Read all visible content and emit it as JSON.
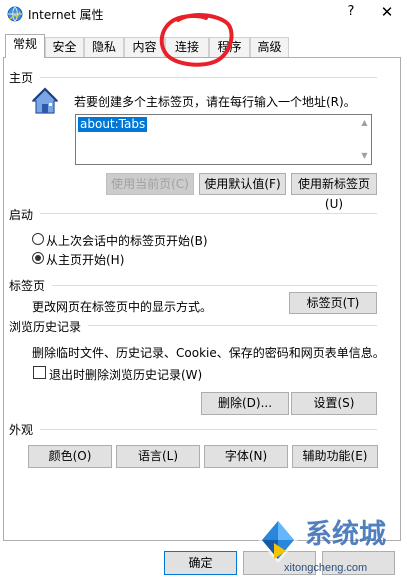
{
  "window": {
    "title": "Internet 属性",
    "help_glyph": "?",
    "close_glyph": "✕"
  },
  "tabs": [
    {
      "label": "常规",
      "active": true
    },
    {
      "label": "安全",
      "active": false
    },
    {
      "label": "隐私",
      "active": false
    },
    {
      "label": "内容",
      "active": false
    },
    {
      "label": "连接",
      "active": false
    },
    {
      "label": "程序",
      "active": false
    },
    {
      "label": "高级",
      "active": false
    }
  ],
  "homepage": {
    "section_title": "主页",
    "description": "若要创建多个主标签页，请在每行输入一个地址(R)。",
    "url_value": "about:Tabs",
    "use_current_label": "使用当前页(C)",
    "use_default_label": "使用默认值(F)",
    "use_new_tab_label": "使用新标签页(U)"
  },
  "startup": {
    "section_title": "启动",
    "option_last_session": "从上次会话中的标签页开始(B)",
    "option_homepage": "从主页开始(H)",
    "selected": "homepage"
  },
  "tabs_section": {
    "section_title": "标签页",
    "description": "更改网页在标签页中的显示方式。",
    "button_label": "标签页(T)"
  },
  "history": {
    "section_title": "浏览历史记录",
    "description": "删除临时文件、历史记录、Cookie、保存的密码和网页表单信息。",
    "checkbox_label": "退出时删除浏览历史记录(W)",
    "checkbox_checked": false,
    "delete_label": "删除(D)...",
    "settings_label": "设置(S)"
  },
  "appearance": {
    "section_title": "外观",
    "colors_label": "颜色(O)",
    "languages_label": "语言(L)",
    "fonts_label": "字体(N)",
    "accessibility_label": "辅助功能(E)"
  },
  "footer": {
    "ok_label": "确定",
    "watermark_text": "系统城",
    "watermark_url": "xitongcheng.com"
  },
  "colors": {
    "accent": "#0078d7",
    "annotation": "#e8202a",
    "watermark": "#3a6fb8"
  }
}
